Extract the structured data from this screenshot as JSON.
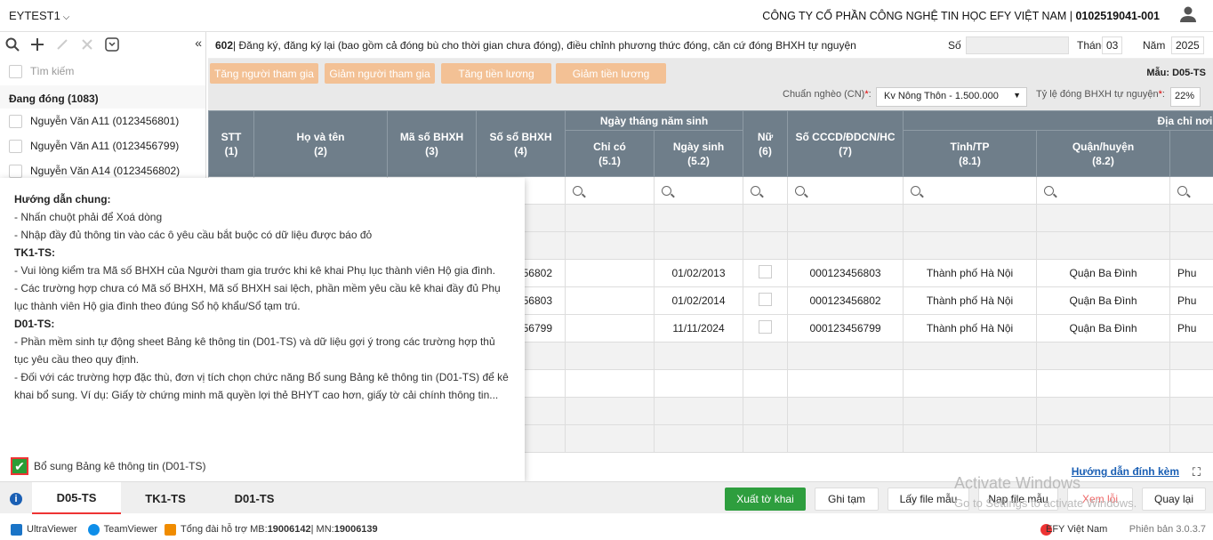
{
  "header": {
    "workspace": "EYTEST1",
    "company": "CÔNG TY CỔ PHẦN CÔNG NGHỆ TIN HỌC EFY VIỆT NAM",
    "tax_code": "0102519041-001"
  },
  "sidebar": {
    "search_placeholder": "Tìm kiếm",
    "group_label": "Đang đóng (1083)",
    "items": [
      "Nguyễn Văn A11 (0123456801)",
      "Nguyễn Văn A11 (0123456799)",
      "Nguyễn Văn A14 (0123456802)"
    ]
  },
  "form": {
    "code": "602",
    "title": " | Đăng ký, đăng ký lại (bao gồm cả đóng bù cho thời gian chưa đóng), điều chỉnh phương thức đóng, căn cứ đóng BHXH tự nguyện",
    "so_label": "Số",
    "so_value": "",
    "thang_label": "Tháng",
    "thang_value": "03",
    "nam_label": "Năm",
    "nam_value": "2025",
    "mau": "Mẫu: D05-TS",
    "chuan_ngheo_label": "Chuẩn nghèo (CN)",
    "chuan_ngheo_value": "Kv Nông Thôn - 1.500.000",
    "ty_le_label": "Tỷ lệ đóng BHXH tự nguyện",
    "ty_le_value": "22%"
  },
  "actions": [
    "Tăng người tham gia",
    "Giảm người tham gia",
    "Tăng tiền lương",
    "Giảm tiền lương"
  ],
  "table": {
    "headers": {
      "stt": "STT",
      "stt_n": "(1)",
      "ho_ten": "Họ và tên",
      "ho_ten_n": "(2)",
      "ma_so": "Mã số BHXH",
      "ma_so_n": "(3)",
      "so_so": "Số sổ BHXH",
      "so_so_n": "(4)",
      "ngay_sinh_group": "Ngày tháng năm sinh",
      "chi_co": "Chỉ có",
      "chi_co_n": "(5.1)",
      "ngay_sinh": "Ngày sinh",
      "ngay_sinh_n": "(5.2)",
      "nu": "Nữ",
      "nu_n": "(6)",
      "cccd": "Số CCCD/ĐDCN/HC",
      "cccd_n": "(7)",
      "dia_chi_group": "Địa chỉ nơi sin",
      "tinh": "Tỉnh/TP",
      "tinh_n": "(8.1)",
      "quan": "Quận/huyện",
      "quan_n": "(8.2)"
    },
    "rows": [
      {
        "so_so": "56802",
        "ngay_sinh": "01/02/2013",
        "cccd": "000123456803",
        "tinh": "Thành phố Hà Nội",
        "quan": "Quận Ba Đình",
        "last": "Phu"
      },
      {
        "so_so": "56803",
        "ngay_sinh": "01/02/2014",
        "cccd": "000123456802",
        "tinh": "Thành phố Hà Nội",
        "quan": "Quận Ba Đình",
        "last": "Phu"
      },
      {
        "so_so": "56799",
        "ngay_sinh": "11/11/2024",
        "cccd": "000123456799",
        "tinh": "Thành phố Hà Nội",
        "quan": "Quận Ba Đình",
        "last": "Phu"
      }
    ]
  },
  "guide": {
    "title": "Hướng dẫn chung:",
    "lines": [
      "- Nhấn chuột phải để Xoá dòng",
      "- Nhập đầy đủ thông tin vào các ô yêu cầu bắt buộc có dữ liệu được báo đỏ"
    ],
    "tk1_title": "TK1-TS:",
    "tk1_lines": [
      "- Vui lòng kiểm tra Mã số BHXH của Người tham gia trước khi kê khai Phụ lục thành viên Hộ gia đình.",
      "- Các trường hợp chưa có Mã số BHXH, Mã số BHXH sai lệch, phần mềm yêu cầu kê khai đầy đủ Phụ lục thành viên Hộ gia đình theo đúng Sổ hộ khẩu/Sổ tạm trú."
    ],
    "d01_title": "D01-TS:",
    "d01_lines": [
      "- Phần mềm sinh tự động sheet Bảng kê thông tin (D01-TS) và dữ liệu gợi ý trong các trường hợp thủ tục yêu cầu theo quy định.",
      "- Đối với các trường hợp đặc thù, đơn vị tích chọn chức năng Bổ sung Bảng kê thông tin (D01-TS) để kê khai bổ sung. Ví dụ: Giấy tờ chứng minh mã quyền lợi thẻ BHYT cao hơn, giấy tờ cải chính thông tin..."
    ],
    "checkbox_label": "Bổ sung Bảng kê thông tin (D01-TS)"
  },
  "guide_link": "Hướng dẫn đính kèm",
  "tabs": [
    "D05-TS",
    "TK1-TS",
    "D01-TS"
  ],
  "buttons": {
    "export": "Xuất tờ khai",
    "save": "Ghi tạm",
    "get_file": "Lấy file mẫu",
    "load_file": "Nạp file mẫu",
    "delete": "Xem lỗi",
    "back": "Quay lại"
  },
  "watermark": {
    "line1": "Activate Windows",
    "line2": "Go to Settings to activate Windows."
  },
  "footer": {
    "ultraviewer": "UltraViewer",
    "teamviewer": "TeamViewer",
    "support_prefix": "Tổng đài hỗ trợ MB: ",
    "mb": "19006142",
    "mn_prefix": " | MN: ",
    "mn": "19006139",
    "brand": "EFY Việt Nam",
    "version": "Phiên bản 3.0.3.7"
  }
}
